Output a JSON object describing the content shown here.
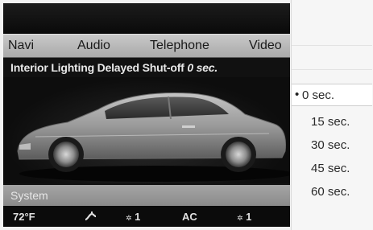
{
  "menu": {
    "items": [
      "Navi",
      "Audio",
      "Telephone",
      "Video"
    ]
  },
  "setting": {
    "title": "Interior Lighting Delayed Shut-off",
    "value": "0 sec."
  },
  "system": {
    "label": "System"
  },
  "status": {
    "temp_left": "72°F",
    "fan_icon": "seat-ventilation-icon",
    "fan_left": "1",
    "ac": "AC",
    "fan_right": "1"
  },
  "options": {
    "bullet": "•",
    "items": [
      "0 sec.",
      "15 sec.",
      "30 sec.",
      "45 sec.",
      "60 sec."
    ],
    "selected_index": 0
  },
  "colors": {
    "screen_bg": "#111111",
    "menubar": "#b9b9b9",
    "car_body": "#9a9a9a",
    "panel_bg": "#f6f6f6"
  }
}
